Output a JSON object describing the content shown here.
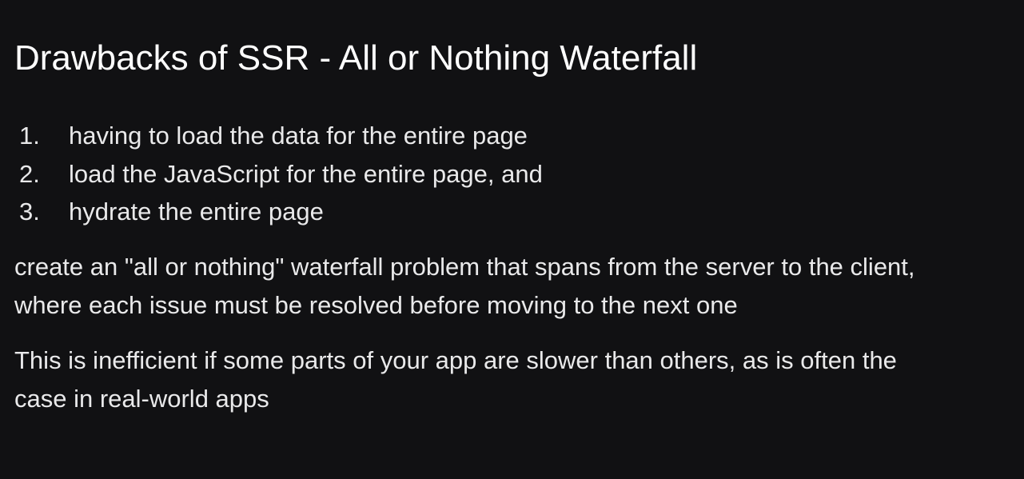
{
  "slide": {
    "title": "Drawbacks of SSR - All or Nothing Waterfall",
    "steps": [
      {
        "number": "1.",
        "text": "having to load the data for the entire page"
      },
      {
        "number": "2.",
        "text": "load the JavaScript for the entire page, and"
      },
      {
        "number": "3.",
        "text": "hydrate the entire page"
      }
    ],
    "paragraphs": [
      {
        "lines": [
          "create an \"all or nothing\" waterfall problem that spans from the server to the client,",
          "where each issue must be resolved before moving to the next one"
        ]
      },
      {
        "lines": [
          "This is inefficient if some parts of your app are slower than others, as is often the",
          "case in real-world apps"
        ]
      }
    ]
  },
  "colors": {
    "background": "#111113",
    "title_text": "#ffffff",
    "body_text": "#e9e9ea"
  }
}
